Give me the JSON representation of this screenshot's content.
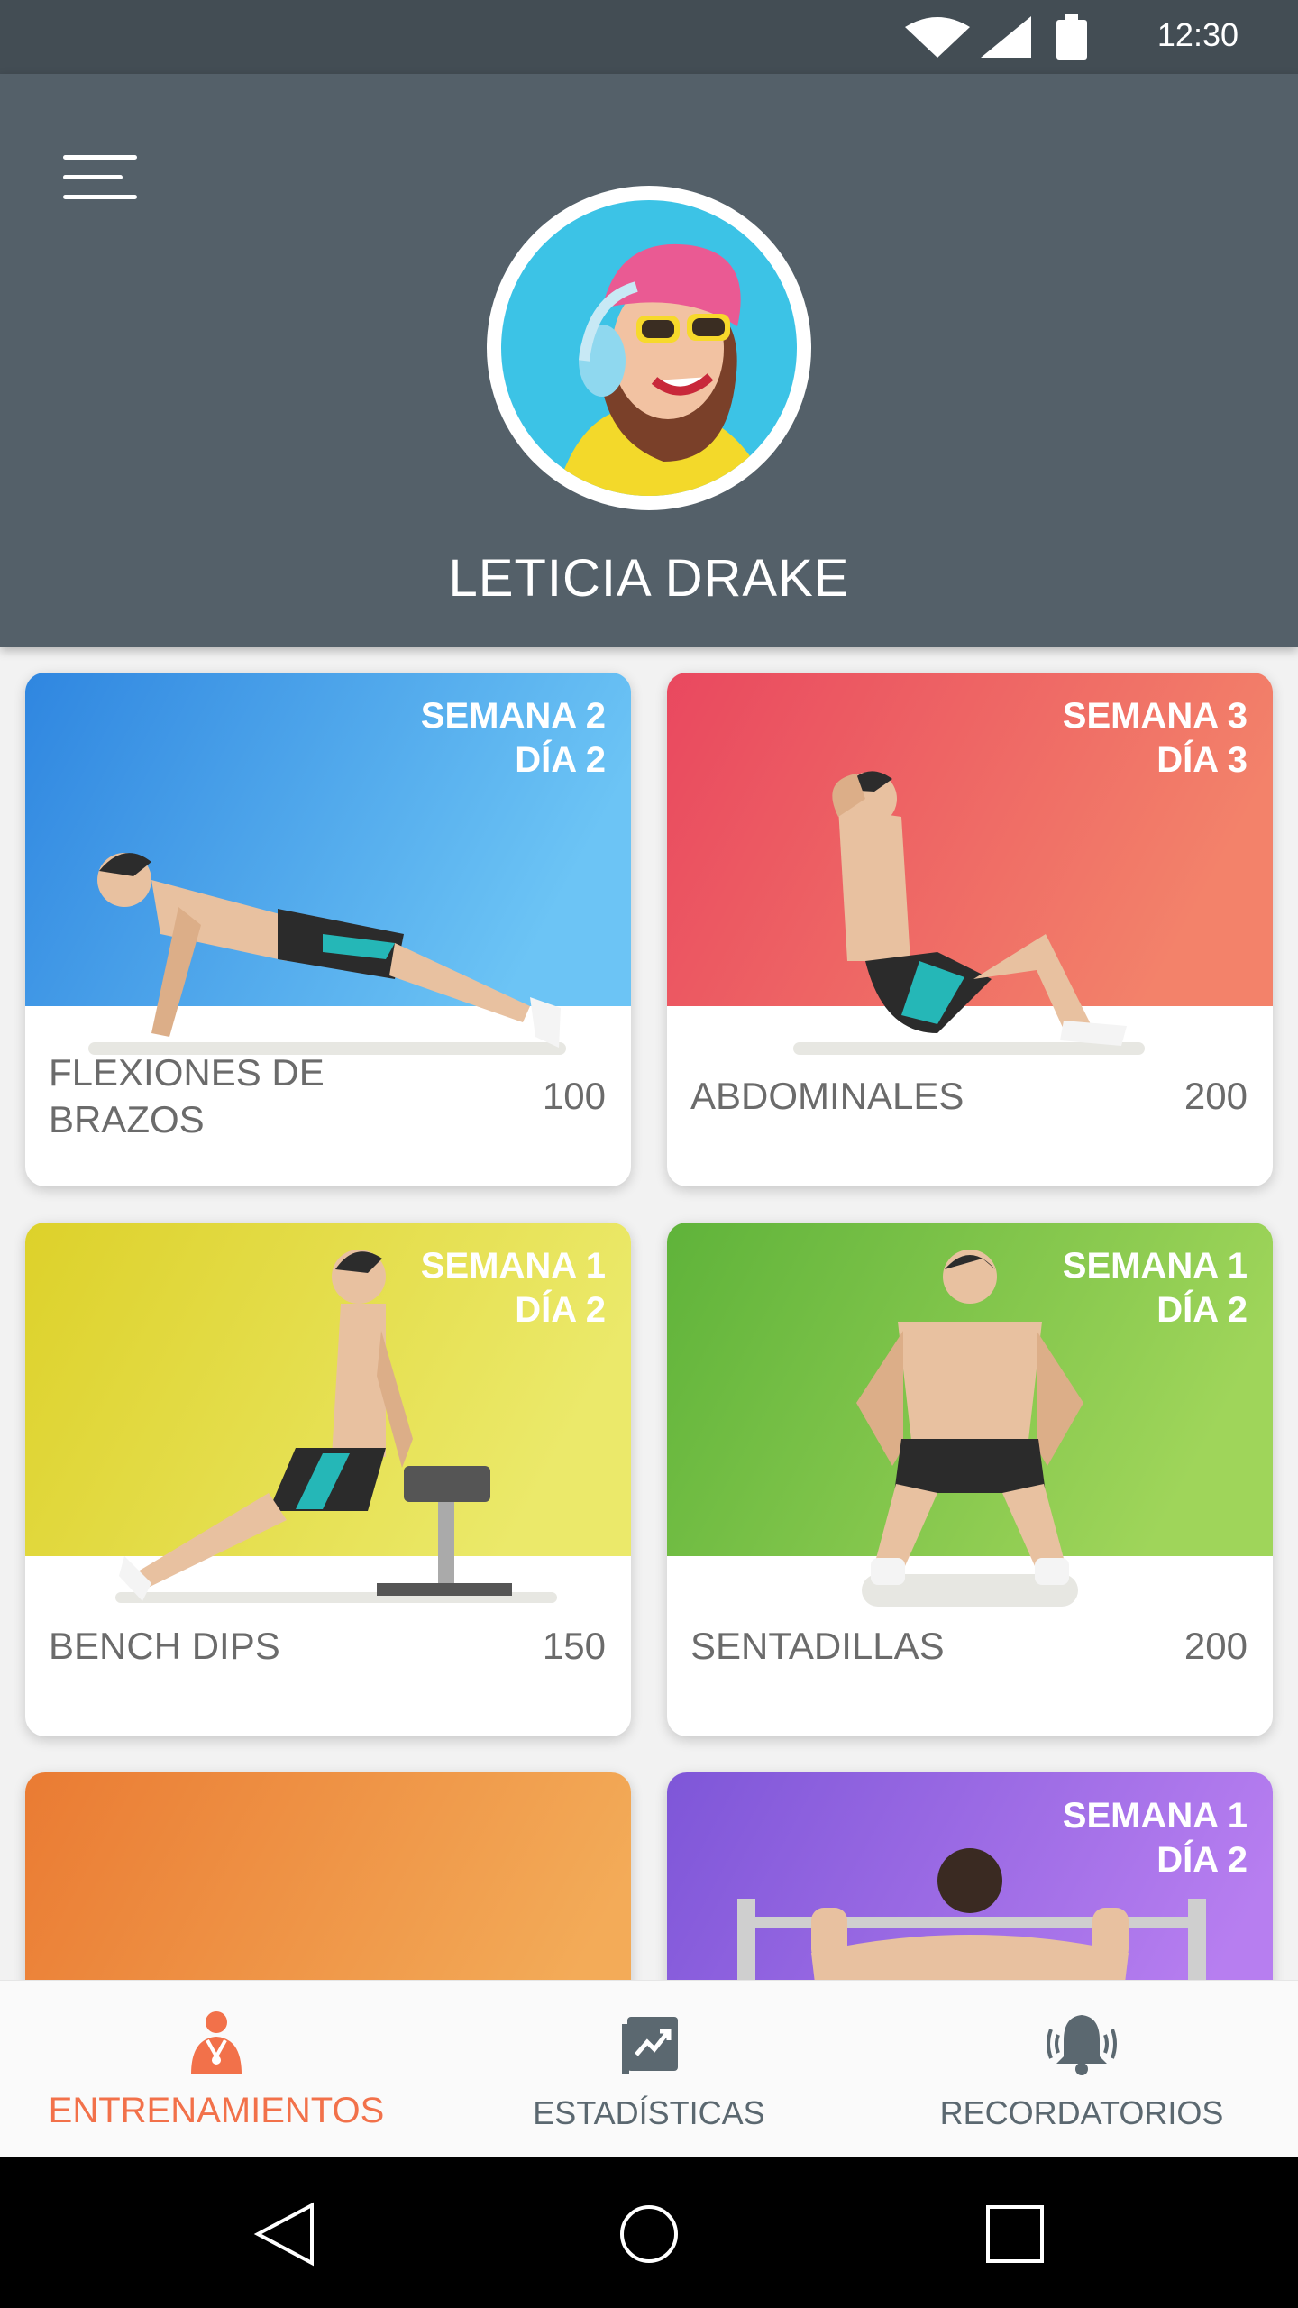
{
  "status_bar": {
    "time": "12:30"
  },
  "profile": {
    "name": "LETICIA DRAKE"
  },
  "workouts": [
    {
      "name": "FLEXIONES DE BRAZOS",
      "count": "100",
      "week": "SEMANA 2",
      "day": "DÍA 2",
      "color": "#3a8fe0"
    },
    {
      "name": "ABDOMINALES",
      "count": "200",
      "week": "SEMANA 3",
      "day": "DÍA 3",
      "color": "#ec5a63"
    },
    {
      "name": "BENCH DIPS",
      "count": "150",
      "week": "SEMANA 1",
      "day": "DÍA 2",
      "color": "#e3d83c"
    },
    {
      "name": "SENTADILLAS",
      "count": "200",
      "week": "SEMANA 1",
      "day": "DÍA 2",
      "color": "#72bb3e"
    },
    {
      "name": "",
      "count": "",
      "week": "",
      "day": "",
      "color": "#ee8a3e"
    },
    {
      "name": "",
      "count": "",
      "week": "SEMANA 1",
      "day": "DÍA 2",
      "color": "#8f63dd"
    }
  ],
  "bottom_nav": {
    "items": [
      {
        "label": "ENTRENAMIENTOS",
        "icon": "trainer-icon",
        "active": true
      },
      {
        "label": "ESTADÍSTICAS",
        "icon": "stats-icon",
        "active": false
      },
      {
        "label": "RECORDATORIOS",
        "icon": "bell-icon",
        "active": false
      }
    ]
  },
  "colors": {
    "header": "#546069",
    "status": "#434d54",
    "accent": "#f2714a",
    "nav_text": "#5b6870"
  }
}
